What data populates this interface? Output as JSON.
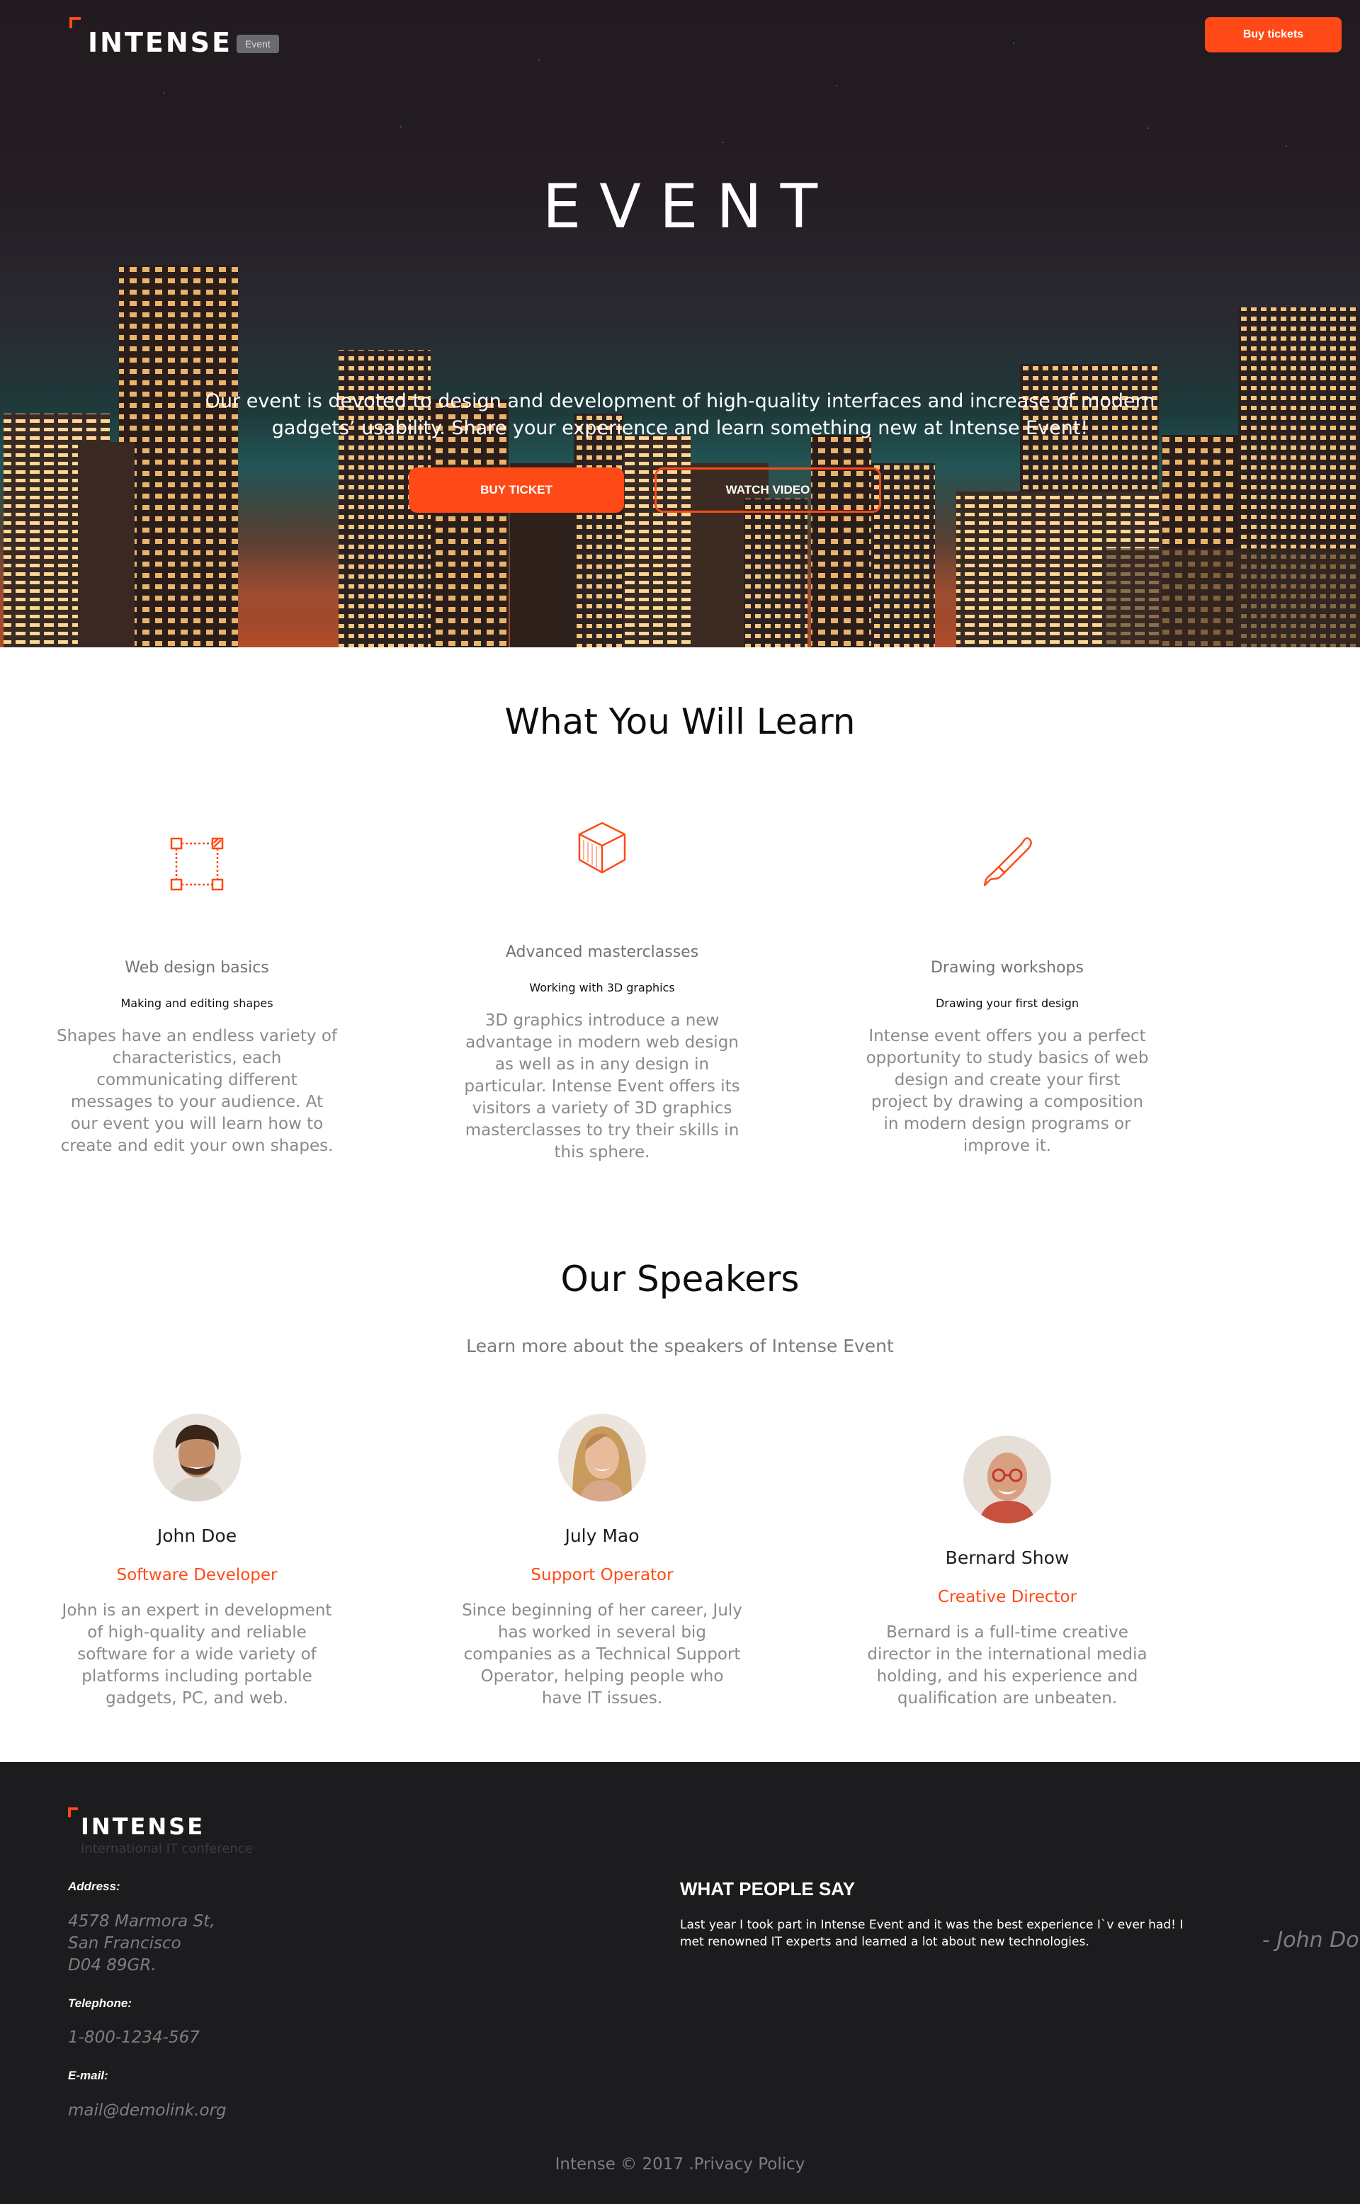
{
  "header": {
    "logo_text": "INTENSE",
    "logo_badge": "Event",
    "buy_tickets": "Buy tickets"
  },
  "hero": {
    "title": "EVENT",
    "description": "Our event is devoted to design and development of high-quality interfaces and increase of modern gadgets’ usability. Share your experience and learn something new at Intense Event!",
    "buy_ticket": "BUY TICKET",
    "watch_video": "WATCH VIDEO"
  },
  "learn": {
    "title": "What You Will Learn",
    "features": [
      {
        "icon": "shapes-icon",
        "heading": "Web design basics",
        "subheading": "Making and editing shapes",
        "text": "Shapes have an endless variety of characteristics, each communicating different messages to your audience. At our event you will learn how to create and edit your own shapes."
      },
      {
        "icon": "cube-icon",
        "heading": "Advanced masterclasses",
        "subheading": "Working with 3D graphics",
        "text": "3D graphics introduce a new advantage in modern web design as well as in any design in particular. Intense Event offers its visitors a variety of 3D graphics masterclasses to try their skills in this sphere."
      },
      {
        "icon": "brush-icon",
        "heading": "Drawing workshops",
        "subheading": "Drawing your first design",
        "text": "Intense event offers you a perfect opportunity to study basics of web design and create your first project by drawing a composition in modern design programs or improve it."
      }
    ]
  },
  "speakers": {
    "title": "Our Speakers",
    "subtitle": "Learn more about the speakers of Intense Event",
    "items": [
      {
        "name": "John Doe",
        "role": "Software Developer",
        "text": "John is an expert in development of high-quality and reliable software for a wide variety of platforms including portable gadgets, PC, and web."
      },
      {
        "name": "July Mao",
        "role": "Support Operator",
        "text": "Since beginning of her career, July has worked in several big companies as a Technical Support Operator, helping people who have IT issues."
      },
      {
        "name": "Bernard Show",
        "role": "Creative Director",
        "text": "Bernard is a full-time creative director in the international media holding, and his experience and qualification are unbeaten."
      }
    ]
  },
  "footer": {
    "logo_text": "INTENSE",
    "tagline": "International IT conference",
    "address_label": "Address:",
    "address_line1": "4578 Marmora St,",
    "address_line2": "San Francisco",
    "address_line3": "D04 89GR.",
    "telephone_label": "Telephone:",
    "telephone": "1-800-1234-567",
    "email_label": "E-mail:",
    "email": "mail@demolink.org",
    "testimonial_title": "WHAT PEOPLE SAY",
    "testimonial_text": "Last year I took part in Intense Event and it was the best experience I`v ever had! I met renowned IT experts and learned a lot about new technologies.",
    "testimonial_author": "- John Doe",
    "copyright": "Intense © 2017 .Privacy Policy"
  },
  "colors": {
    "accent": "#ff4a17",
    "footer_bg": "#1c1c1e",
    "muted_text": "#8a8a8a"
  }
}
